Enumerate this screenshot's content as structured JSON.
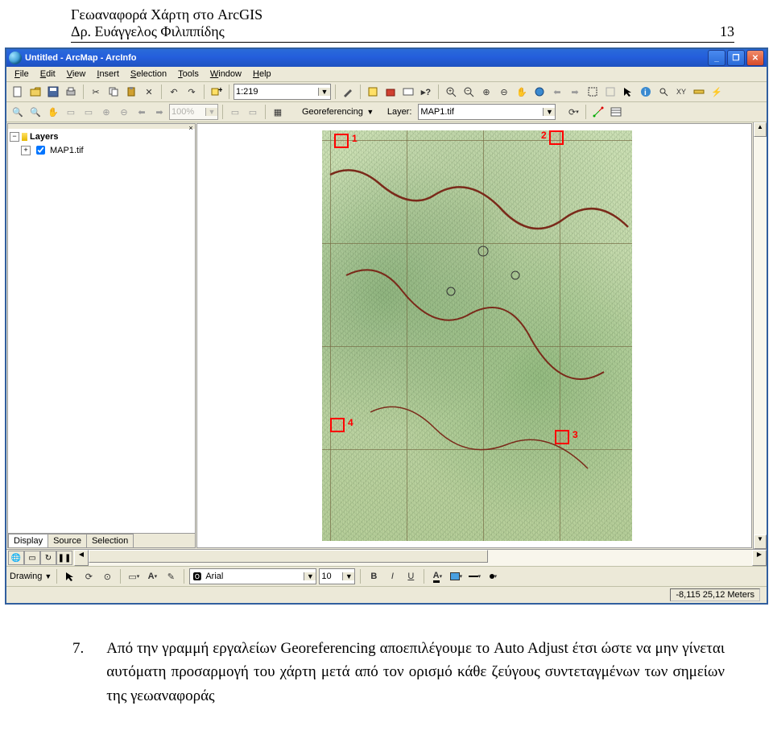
{
  "doc": {
    "header_line1": "Γεωαναφορά Χάρτη στο ArcGIS",
    "header_author": "Δρ. Ευάγγελος Φιλιππίδης",
    "page_no": "13",
    "step_no": "7.",
    "body": "Από την γραμμή εργαλείων Georeferencing αποεπιλέγουμε το Auto Adjust έτσι ώστε να μην γίνεται αυτόματη προσαρμογή του χάρτη μετά από τον ορισμό κάθε ζεύγους συντεταγμένων των σημείων της γεωαναφοράς"
  },
  "app": {
    "title": "Untitled - ArcMap - ArcInfo"
  },
  "menu": {
    "file": "File",
    "edit": "Edit",
    "view": "View",
    "insert": "Insert",
    "selection": "Selection",
    "tools": "Tools",
    "window": "Window",
    "help": "Help"
  },
  "toolbar1": {
    "scale": "1:219"
  },
  "toolbar2": {
    "zoom": "100%",
    "georef_label": "Georeferencing",
    "layer_label": "Layer:",
    "layer_value": "MAP1.tif"
  },
  "toc": {
    "root": "Layers",
    "item0": "MAP1.tif",
    "tab_display": "Display",
    "tab_source": "Source",
    "tab_selection": "Selection"
  },
  "control_points": {
    "p1": "1",
    "p2": "2",
    "p3": "3",
    "p4": "4"
  },
  "draw": {
    "label": "Drawing",
    "font": "Arial",
    "size": "10"
  },
  "status": {
    "coords": "-8,115  25,12 Meters"
  }
}
